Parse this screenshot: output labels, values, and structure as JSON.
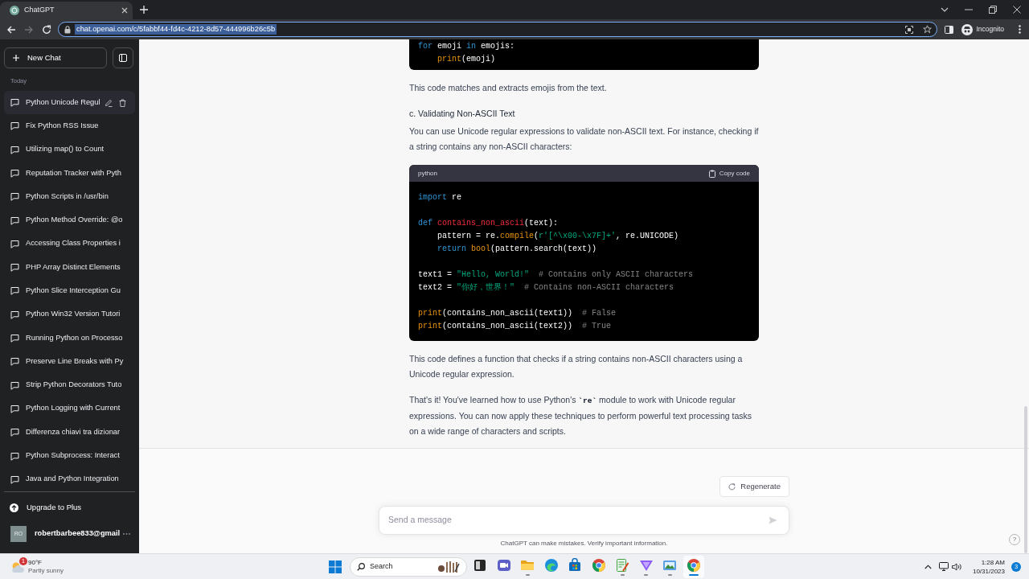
{
  "browser": {
    "tabs": [
      {
        "title": "ChatGPT",
        "selected": true
      }
    ],
    "navigation": {
      "back_disabled": false,
      "forward_disabled": true
    },
    "address_bar": {
      "url": "chat.openai.com/c/5fabbf44-fd4c-4212-8d57-444996b26c5b",
      "highlighted": true
    },
    "profile": "Incognito"
  },
  "sidebar": {
    "new_chat": "New Chat",
    "section": "Today",
    "chats": [
      {
        "title": "Python Unicode Regul",
        "selected": true
      },
      {
        "title": "Fix Python RSS Issue",
        "selected": false
      },
      {
        "title": "Utilizing map() to Count",
        "selected": false
      },
      {
        "title": "Reputation Tracker with Pyth",
        "selected": false
      },
      {
        "title": "Python Scripts in /usr/bin",
        "selected": false
      },
      {
        "title": "Python Method Override: @o",
        "selected": false
      },
      {
        "title": "Accessing Class Properties i",
        "selected": false
      },
      {
        "title": "PHP Array Distinct Elements",
        "selected": false
      },
      {
        "title": "Python Slice Interception Gu",
        "selected": false
      },
      {
        "title": "Python Win32 Version Tutori",
        "selected": false
      },
      {
        "title": "Running Python on Processo",
        "selected": false
      },
      {
        "title": "Preserve Line Breaks with Py",
        "selected": false
      },
      {
        "title": "Strip Python Decorators Tuto",
        "selected": false
      },
      {
        "title": "Python Logging with Current",
        "selected": false
      },
      {
        "title": "Differenza chiavi tra dizionar",
        "selected": false
      },
      {
        "title": "Python Subprocess: Interact",
        "selected": false
      },
      {
        "title": "Java and Python Integration",
        "selected": false
      }
    ],
    "upgrade": "Upgrade to Plus",
    "user": {
      "initials": "RO",
      "email": "robertbarbee833@gmail"
    }
  },
  "conversation": {
    "blocks": [
      {
        "kind": "code",
        "groups": [
          [
            [
              {
                "kind": "keyword",
                "text": "for"
              },
              {
                "kind": "plain",
                "text": " emoji "
              },
              {
                "kind": "keyword",
                "text": "in"
              },
              {
                "kind": "plain",
                "text": " emojis:"
              }
            ],
            [
              {
                "kind": "builtin",
                "text": "    print"
              },
              {
                "kind": "plain",
                "text": "(emoji)"
              }
            ]
          ]
        ]
      },
      {
        "kind": "paragraph",
        "text": "This code matches and extracts emojis from the text."
      },
      {
        "kind": "heading",
        "text": "c. Validating Non-ASCII Text"
      },
      {
        "kind": "paragraph",
        "text": "You can use Unicode regular expressions to validate non-ASCII text. For instance, checking if a string contains any non-ASCII characters:"
      },
      {
        "kind": "code",
        "language": "python",
        "copy_label": "Copy code",
        "groups": [
          [
            [
              {
                "kind": "keyword",
                "text": "import"
              },
              {
                "kind": "plain",
                "text": " re"
              }
            ]
          ],
          [
            [
              {
                "kind": "keyword",
                "text": "def "
              },
              {
                "kind": "function",
                "text": "contains_non_ascii"
              },
              {
                "kind": "plain",
                "text": "(text):"
              }
            ],
            [
              {
                "kind": "plain",
                "text": "    pattern = re."
              },
              {
                "kind": "builtin",
                "text": "compile"
              },
              {
                "kind": "plain",
                "text": "("
              },
              {
                "kind": "string",
                "text": "r'[^\\x00-\\x7F]+'"
              },
              {
                "kind": "plain",
                "text": ", re.UNICODE)"
              }
            ],
            [
              {
                "kind": "keyword",
                "text": "    return "
              },
              {
                "kind": "builtin",
                "text": "bool"
              },
              {
                "kind": "plain",
                "text": "(pattern.search(text))"
              }
            ]
          ],
          [
            [
              {
                "kind": "plain",
                "text": "text1 = "
              },
              {
                "kind": "string",
                "text": "\"Hello, World!\""
              },
              {
                "kind": "comment",
                "text": "  # Contains only ASCII characters"
              }
            ],
            [
              {
                "kind": "plain",
                "text": "text2 = "
              },
              {
                "kind": "string",
                "text": "\"你好，世界！\""
              },
              {
                "kind": "comment",
                "text": "  # Contains non-ASCII characters"
              }
            ]
          ],
          [
            [
              {
                "kind": "builtin",
                "text": "print"
              },
              {
                "kind": "plain",
                "text": "(contains_non_ascii(text1))  "
              },
              {
                "kind": "comment",
                "text": "# False"
              }
            ],
            [
              {
                "kind": "builtin",
                "text": "print"
              },
              {
                "kind": "plain",
                "text": "(contains_non_ascii(text2))  "
              },
              {
                "kind": "comment",
                "text": "# True"
              }
            ]
          ]
        ]
      },
      {
        "kind": "paragraph",
        "text": "This code defines a function that checks if a string contains non-ASCII characters using a Unicode regular expression."
      },
      {
        "kind": "paragraph",
        "segments": [
          {
            "kind": "text",
            "text": "That's it! You've learned how to use Python's "
          },
          {
            "kind": "code",
            "text": "`re`"
          },
          {
            "kind": "text",
            "text": " module to work with Unicode regular expressions. You can now apply these techniques to perform powerful text processing tasks on a wide range of characters and scripts."
          }
        ]
      }
    ]
  },
  "composer": {
    "regenerate": "Regenerate",
    "placeholder": "Send a message",
    "send_disabled": true,
    "disclaimer": "ChatGPT can make mistakes. Verify important information.",
    "help": "?"
  },
  "taskbar": {
    "weather": {
      "badge": "1",
      "temperature": "90°F",
      "condition": "Partly sunny"
    },
    "search": {
      "label": "Search"
    },
    "apps": [
      {
        "kind": "tile",
        "running": false,
        "selected": false
      },
      {
        "kind": "camera",
        "running": false,
        "selected": false
      },
      {
        "kind": "folder",
        "running": true,
        "selected": false
      },
      {
        "kind": "swirl",
        "running": false,
        "selected": false
      },
      {
        "kind": "store",
        "running": false,
        "selected": false
      },
      {
        "kind": "circle",
        "running": false,
        "selected": false
      },
      {
        "kind": "notepad",
        "running": true,
        "selected": false
      },
      {
        "kind": "triangle",
        "running": true,
        "selected": false
      },
      {
        "kind": "picture",
        "running": true,
        "selected": false
      },
      {
        "kind": "circle",
        "running": true,
        "selected": true
      }
    ],
    "clock": {
      "time": "1:28 AM",
      "date": "10/31/2023"
    },
    "notifications": "3"
  }
}
